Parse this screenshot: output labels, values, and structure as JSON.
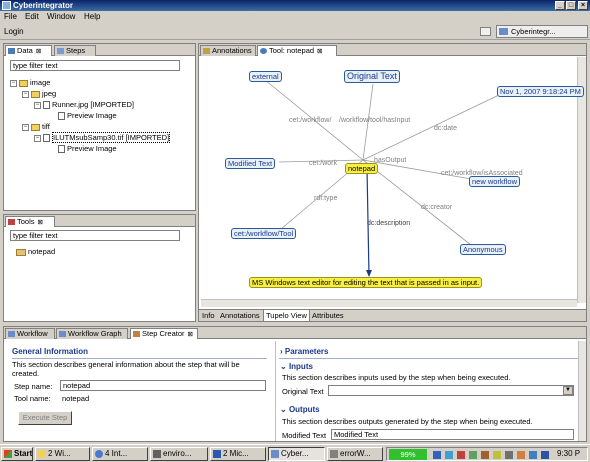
{
  "window": {
    "title": "Cyberintegrator",
    "controls": [
      "_",
      "□",
      "×"
    ]
  },
  "menu": [
    "File",
    "Edit",
    "Window",
    "Help"
  ],
  "toolbar": {
    "login": "Login",
    "perspective": "Cyberintegr..."
  },
  "data_panel": {
    "tabs": [
      {
        "label": "Data",
        "close": "⊠"
      },
      {
        "label": "Steps"
      }
    ],
    "filter_placeholder": "type filter text",
    "tree": [
      {
        "label": "image"
      },
      {
        "label": "jpeg"
      },
      {
        "label": "Runner.jpg [IMPORTED]"
      },
      {
        "label": "Preview Image"
      },
      {
        "label": "tiff"
      },
      {
        "label": "ILUTMsubSamp30.tif [IMPORTED]"
      },
      {
        "label": "Preview Image"
      }
    ]
  },
  "tools_panel": {
    "tab": "Tools",
    "close": "⊠",
    "filter_placeholder": "type filter text",
    "items": [
      "notepad"
    ]
  },
  "graph_panel": {
    "tabs": [
      {
        "label": "Annotations"
      },
      {
        "label": "Tool: notepad",
        "close": "⊠"
      }
    ],
    "nodes": {
      "center": "notepad",
      "external": "external",
      "original_text": "Original Text",
      "date": "Nov 1, 2007 9:18:24 PM",
      "modified_text": "Modified Text",
      "new_workflow": "new workflow",
      "workflow_tool": "cet:/workflow/Tool",
      "anonymous": "Anonymous",
      "description": "MS Windows text editor for editing the text that is passed in as input."
    },
    "edge_labels": {
      "e1": "cet:/workflow/",
      "e2": "/workflow/tool/hasInput",
      "e3": "dc:date",
      "e4": "cet:/work",
      "e5": "hasOutput",
      "e6": "cet:/workflow/isAssociated",
      "e7": "rdf:type",
      "e8": "dc:creator",
      "e9": "dc:description"
    },
    "bottom_tabs": [
      "Info",
      "Annotations",
      "Tupelo View",
      "Attributes"
    ]
  },
  "bottom_panel": {
    "tabs": [
      {
        "label": "Workflow"
      },
      {
        "label": "Workflow Graph"
      },
      {
        "label": "Step Creator",
        "close": "⊠"
      }
    ],
    "general": {
      "title": "General Information",
      "desc": "This section describes general information about the step that will be created.",
      "step_name_label": "Step name:",
      "step_name_value": "notepad",
      "tool_name_label": "Tool name:",
      "tool_name_value": "notepad",
      "execute": "Execute Step"
    },
    "parameters": "Parameters",
    "inputs": {
      "title": "Inputs",
      "desc": "This section describes inputs used by the step when being executed.",
      "field_label": "Original Text"
    },
    "outputs": {
      "title": "Outputs",
      "desc": "This section describes outputs generated by the step when being executed.",
      "field_label": "Modified Text",
      "field_value": "Modified Text"
    }
  },
  "taskbar": {
    "start": "Start",
    "tasks": [
      "2 Wi...",
      "4 Int...",
      "enviro...",
      "2 Mic...",
      "Cyber...",
      "errorW..."
    ],
    "battery": "99%",
    "time": "9:30 P"
  }
}
